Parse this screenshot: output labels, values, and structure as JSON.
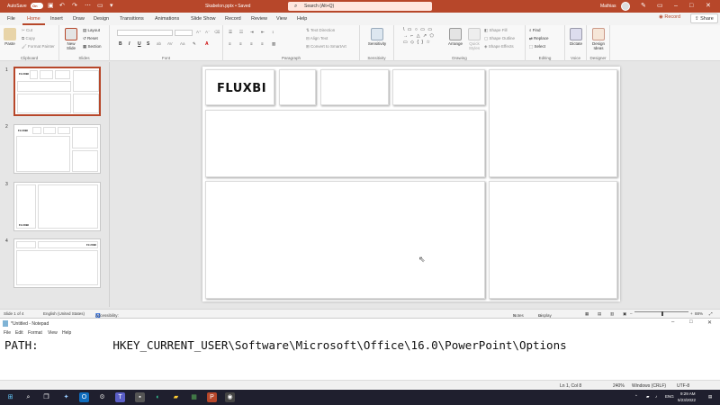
{
  "titlebar": {
    "autosave_label": "AutoSave",
    "autosave_state": "On",
    "doc_title": "Skabelon.pptx • Saved",
    "search_placeholder": "Search (Alt+Q)",
    "user_name": "Mathias"
  },
  "tabs": [
    "File",
    "Home",
    "Insert",
    "Draw",
    "Design",
    "Transitions",
    "Animations",
    "Slide Show",
    "Record",
    "Review",
    "View",
    "Help"
  ],
  "active_tab": "Home",
  "record_label": "Record",
  "share_label": "Share",
  "ribbon": {
    "clipboard": {
      "paste": "Paste",
      "cut": "Cut",
      "copy": "Copy",
      "format_painter": "Format Painter",
      "label": "Clipboard"
    },
    "slides": {
      "new_slide": "New Slide",
      "layout": "Layout",
      "reset": "Reset",
      "section": "Section",
      "label": "Slides"
    },
    "font": {
      "label": "Font",
      "bold": "B",
      "italic": "I",
      "underline": "U",
      "strike": "S",
      "font_color": "A"
    },
    "paragraph": {
      "text_direction": "Text Direction",
      "align_text": "Align Text",
      "smartart": "Convert to SmartArt",
      "label": "Paragraph"
    },
    "sensitivity": {
      "button": "Sensitivity",
      "label": "Sensitivity"
    },
    "drawing": {
      "arrange": "Arrange",
      "quick_styles": "Quick Styles",
      "shape_fill": "Shape Fill",
      "shape_outline": "Shape Outline",
      "shape_effects": "Shape Effects",
      "label": "Drawing"
    },
    "editing": {
      "find": "Find",
      "replace": "Replace",
      "select": "Select",
      "label": "Editing"
    },
    "voice": {
      "dictate": "Dictate",
      "label": "Voice"
    },
    "designer": {
      "design_ideas": "Design Ideas",
      "label": "Designer"
    }
  },
  "thumbnails": [
    {
      "number": "1",
      "logo": "FLUXBI"
    },
    {
      "number": "2",
      "logo": "FLUXBI"
    },
    {
      "number": "3",
      "logo": "FLUXBI"
    },
    {
      "number": "4",
      "logo": "FLUXBI"
    }
  ],
  "slide": {
    "logo": "FLUXBI"
  },
  "statusbar": {
    "slide_count": "Slide 1 of 4",
    "language": "English (United States)",
    "accessibility": "Accessibility: Investigate",
    "notes": "Notes",
    "display_settings": "Display Settings",
    "zoom": "88%"
  },
  "notepad": {
    "title": "*Untitled - Notepad",
    "menu": [
      "File",
      "Edit",
      "Format",
      "View",
      "Help"
    ],
    "content": "PATH:           HKEY_CURRENT_USER\\Software\\Microsoft\\Office\\16.0\\PowerPoint\\Options",
    "position": "Ln 1, Col 8",
    "zoom": "240%",
    "line_endings": "Windows (CRLF)",
    "encoding": "UTF-8"
  },
  "taskbar": {
    "language": "ENG",
    "time": "9:29 AM",
    "date": "5/23/2022"
  },
  "colors": {
    "accent": "#b7472a",
    "taskbar": "#1f1f2e"
  }
}
